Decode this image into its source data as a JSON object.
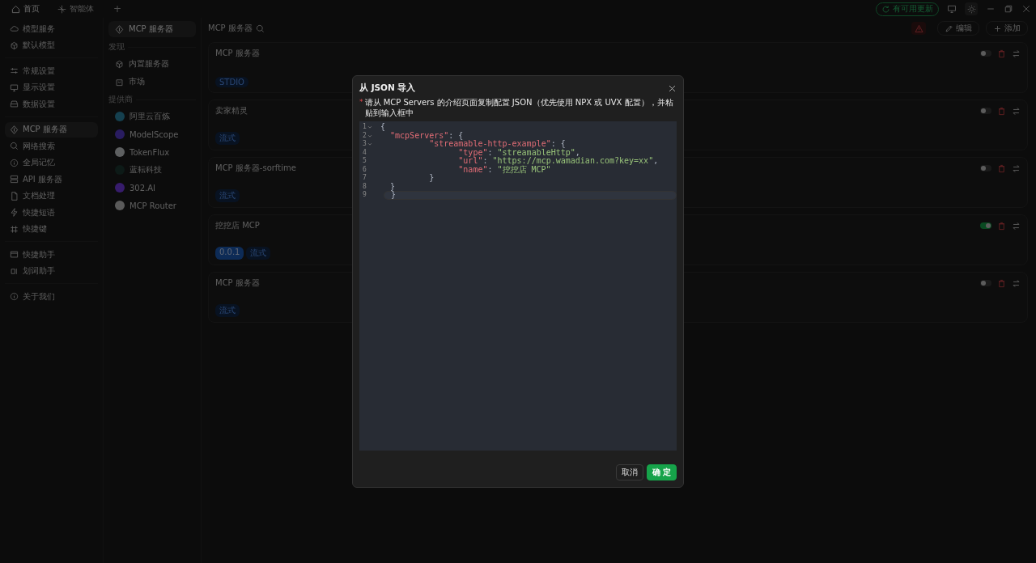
{
  "topbar": {
    "tabs": [
      {
        "label": "首页",
        "selected": true
      },
      {
        "label": "智能体",
        "selected": false
      }
    ],
    "new_tab": "+",
    "update_badge": "有可用更新"
  },
  "sidebar": {
    "groups": [
      {
        "items": [
          {
            "label": "模型服务",
            "selected": false
          },
          {
            "label": "默认模型",
            "selected": false
          }
        ]
      },
      {
        "items": [
          {
            "label": "常规设置",
            "selected": false
          },
          {
            "label": "显示设置",
            "selected": false
          },
          {
            "label": "数据设置",
            "selected": false
          }
        ]
      },
      {
        "items": [
          {
            "label": "MCP 服务器",
            "selected": true
          },
          {
            "label": "网络搜索",
            "selected": false
          },
          {
            "label": "全局记忆",
            "selected": false
          },
          {
            "label": "API 服务器",
            "selected": false
          },
          {
            "label": "文档处理",
            "selected": false
          },
          {
            "label": "快捷短语",
            "selected": false
          },
          {
            "label": "快捷键",
            "selected": false
          }
        ]
      },
      {
        "items": [
          {
            "label": "快捷助手",
            "selected": false
          },
          {
            "label": "划词助手",
            "selected": false
          }
        ]
      },
      {
        "items": [
          {
            "label": "关于我们",
            "selected": false
          }
        ]
      }
    ]
  },
  "subnav": {
    "top": {
      "label": "MCP 服务器",
      "selected": true
    },
    "sections": [
      {
        "title": "发现",
        "items": [
          {
            "label": "内置服务器",
            "selected": false
          },
          {
            "label": "市场",
            "selected": false
          }
        ]
      },
      {
        "title": "提供商",
        "items": [
          {
            "label": "阿里云百炼",
            "selected": false,
            "kind": "provider"
          },
          {
            "label": "ModelScope",
            "selected": false,
            "kind": "provider"
          },
          {
            "label": "TokenFlux",
            "selected": false,
            "kind": "provider"
          },
          {
            "label": "蓝耘科技",
            "selected": false,
            "kind": "provider"
          },
          {
            "label": "302.AI",
            "selected": false,
            "kind": "provider"
          },
          {
            "label": "MCP Router",
            "selected": false,
            "kind": "provider"
          }
        ]
      }
    ]
  },
  "main": {
    "title": "MCP 服务器",
    "actions": [
      {
        "label": "编辑",
        "kind": "edit"
      },
      {
        "label": "添加",
        "kind": "add"
      }
    ],
    "servers": [
      {
        "name": "MCP 服务器",
        "on": false,
        "tags": [
          {
            "text": "STDIO",
            "kind": "type"
          }
        ]
      },
      {
        "name": "卖家精灵",
        "on": false,
        "tags": [
          {
            "text": "流式",
            "kind": "type"
          }
        ]
      },
      {
        "name": "MCP 服务器-sorftime",
        "on": false,
        "tags": [
          {
            "text": "流式",
            "kind": "type"
          }
        ]
      },
      {
        "name": "挖挖店 MCP",
        "on": true,
        "tags": [
          {
            "text": "0.0.1",
            "kind": "version"
          },
          {
            "text": "流式",
            "kind": "type"
          }
        ]
      },
      {
        "name": "MCP 服务器",
        "on": false,
        "tags": [
          {
            "text": "流式",
            "kind": "type"
          }
        ]
      }
    ]
  },
  "dialog": {
    "title": "从 JSON 导入",
    "required_mark": "*",
    "prompt": "请从 MCP Servers 的介绍页面复制配置 JSON（优先使用 NPX 或 UVX 配置），并粘贴到输入框中",
    "editor": {
      "lines": [
        {
          "number": "1",
          "foldable": true,
          "active": false,
          "tokens": [
            {
              "kind": "punct",
              "text": "{"
            }
          ]
        },
        {
          "number": "2",
          "foldable": true,
          "active": false,
          "tokens": [
            {
              "kind": "key",
              "text": "  \"mcpServers\""
            },
            {
              "kind": "punct",
              "text": ": {"
            }
          ]
        },
        {
          "number": "3",
          "foldable": true,
          "active": false,
          "tokens": [
            {
              "kind": "key",
              "text": "          \"streamable-http-example\""
            },
            {
              "kind": "punct",
              "text": ": {"
            }
          ]
        },
        {
          "number": "4",
          "foldable": false,
          "active": false,
          "tokens": [
            {
              "kind": "key",
              "text": "                \"type\""
            },
            {
              "kind": "punct",
              "text": ": "
            },
            {
              "kind": "string",
              "text": "\"streamableHttp\""
            },
            {
              "kind": "punct",
              "text": ","
            }
          ]
        },
        {
          "number": "5",
          "foldable": false,
          "active": false,
          "tokens": [
            {
              "kind": "key",
              "text": "                \"url\""
            },
            {
              "kind": "punct",
              "text": ": "
            },
            {
              "kind": "string",
              "text": "\"https://mcp.wamadian.com?key=xx\""
            },
            {
              "kind": "punct",
              "text": ","
            }
          ]
        },
        {
          "number": "6",
          "foldable": false,
          "active": false,
          "tokens": [
            {
              "kind": "key",
              "text": "                \"name\""
            },
            {
              "kind": "punct",
              "text": ": "
            },
            {
              "kind": "string",
              "text": "\"挖挖店 MCP\""
            }
          ]
        },
        {
          "number": "7",
          "foldable": false,
          "active": false,
          "tokens": [
            {
              "kind": "punct",
              "text": "          }"
            }
          ]
        },
        {
          "number": "8",
          "foldable": false,
          "active": false,
          "tokens": [
            {
              "kind": "punct",
              "text": "  }"
            }
          ]
        },
        {
          "number": "9",
          "foldable": false,
          "active": true,
          "tokens": [
            {
              "kind": "punct",
              "text": "}"
            }
          ]
        }
      ]
    },
    "buttons": [
      {
        "label": "取消",
        "kind": "secondary"
      },
      {
        "label": "确 定",
        "kind": "primary"
      }
    ]
  }
}
